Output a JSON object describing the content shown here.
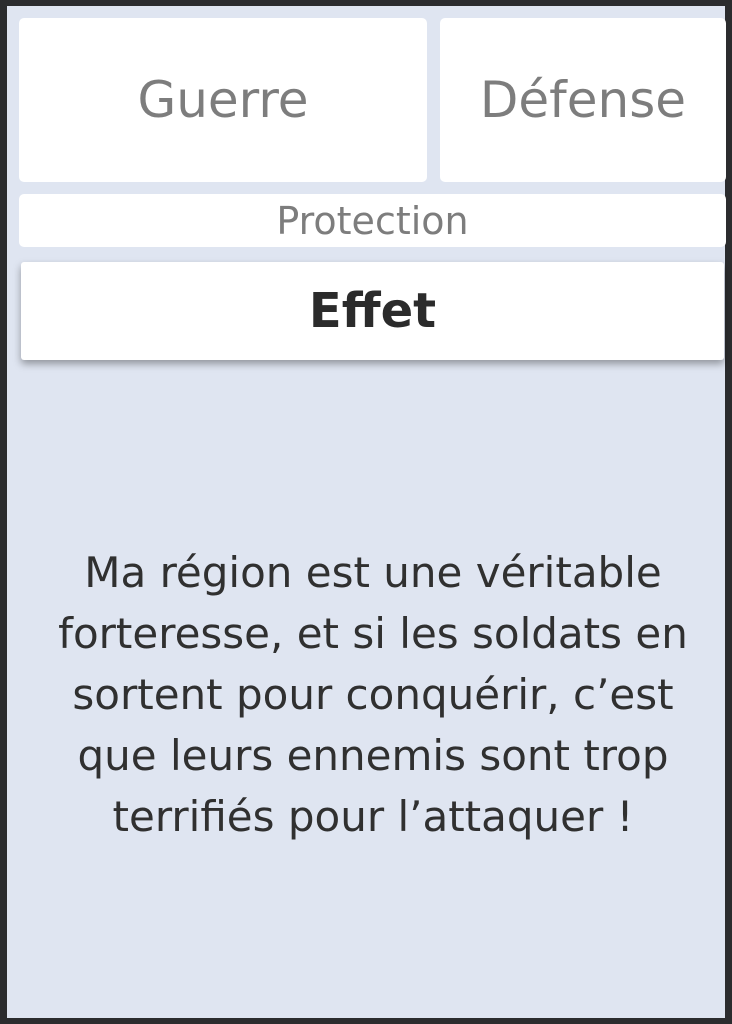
{
  "tabs": {
    "guerre": "Guerre",
    "defense": "Défense",
    "protection": "Protection"
  },
  "section": {
    "title": "Effet"
  },
  "effect": {
    "line1": "Ma région est une véritable",
    "line2": "forteresse, et si les soldats en",
    "line3": "sortent pour conquérir, c’est",
    "line4": "que leurs ennemis sont trop",
    "line5": "terrifiés pour l’attaquer !"
  },
  "colors": {
    "background": "#dfe5f1",
    "panel": "#ffffff",
    "frame": "#2b2c2e",
    "muted_text": "#7d7d7d",
    "main_text": "#303030"
  }
}
